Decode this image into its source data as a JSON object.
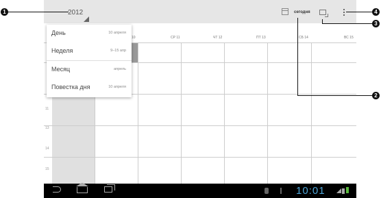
{
  "actionbar": {
    "year": "2012",
    "today_label": "сегодня",
    "icons": [
      "calendar-icon",
      "month-grid-icon",
      "overflow-menu-icon"
    ]
  },
  "day_headers": [
    {
      "label": "10"
    },
    {
      "label": "СР 11"
    },
    {
      "label": "ЧТ 12"
    },
    {
      "label": "ПТ 13"
    },
    {
      "label": "СБ 14"
    },
    {
      "label": "ВС 15"
    }
  ],
  "hours": [
    "11",
    "13",
    "14",
    "15"
  ],
  "dropdown": {
    "items": [
      {
        "label": "День",
        "value": "10 апреля"
      },
      {
        "label": "Неделя",
        "value": "9–15 апр"
      },
      {
        "label": "Месяц",
        "value": "апрель"
      },
      {
        "label": "Повестка дня",
        "value": "10 апреля"
      }
    ]
  },
  "statusbar": {
    "time": "10:01"
  },
  "callouts": [
    "1",
    "2",
    "3",
    "4"
  ]
}
